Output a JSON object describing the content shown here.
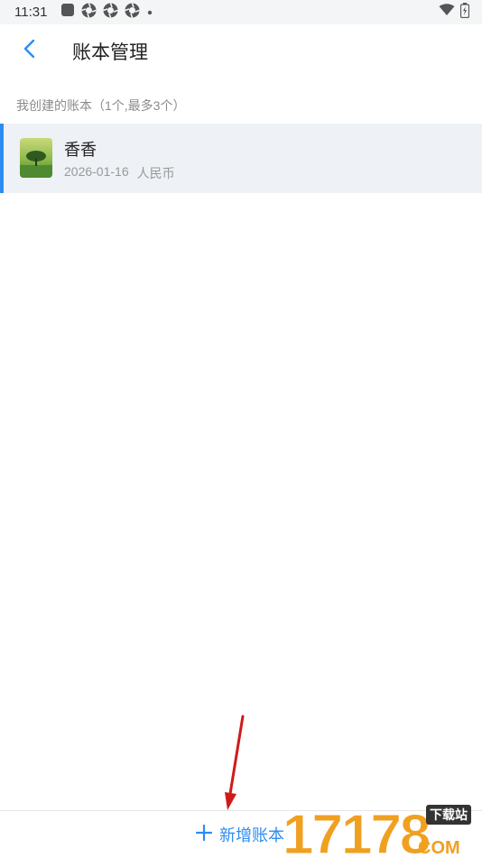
{
  "status_bar": {
    "time": "11:31"
  },
  "header": {
    "title": "账本管理"
  },
  "section": {
    "label": "我创建的账本（1个,最多3个）"
  },
  "ledgers": [
    {
      "name": "香香",
      "date": "2026-01-16",
      "currency": "人民币",
      "thumbnail_icon": "tree-photo-icon"
    }
  ],
  "bottom": {
    "add_label": "新增账本"
  },
  "watermark": {
    "text": "17178",
    "badge": "下载站",
    "suffix": "COM"
  },
  "colors": {
    "accent": "#2d8cf0",
    "selected_row": "#eef1f5",
    "arrow": "#d11a1a"
  },
  "icons": {
    "back": "chevron-left-icon",
    "add": "plus-icon"
  }
}
